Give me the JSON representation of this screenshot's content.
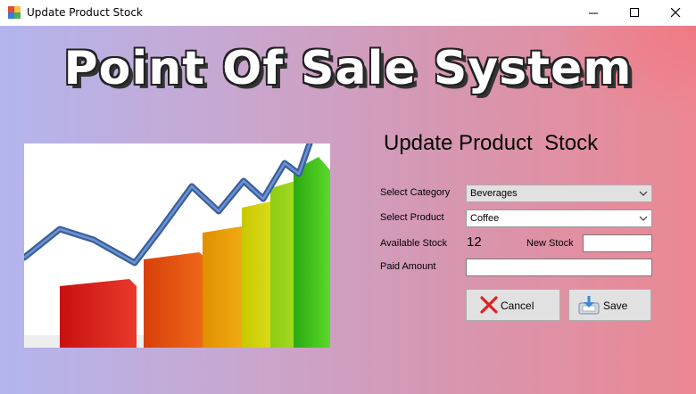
{
  "window": {
    "title": "Update Product Stock",
    "controls": {
      "minimize": "minimize-icon",
      "maximize": "maximize-icon",
      "close": "close-icon"
    }
  },
  "banner": {
    "text": "Point Of Sale System"
  },
  "form": {
    "title": "Update Product  Stock",
    "labels": {
      "category": "Select Category",
      "product": "Select Product",
      "available": "Available Stock",
      "new_stock": "New Stock",
      "paid_amount": "Paid Amount"
    },
    "category": {
      "value": "Beverages"
    },
    "product": {
      "value": "Coffee"
    },
    "available_stock": "12",
    "new_stock": {
      "value": ""
    },
    "paid_amount": {
      "value": ""
    }
  },
  "buttons": {
    "cancel": {
      "label": "Cancel",
      "icon": "red-x-icon"
    },
    "save": {
      "label": "Save",
      "icon": "save-icon"
    }
  },
  "colors": {
    "bg_left": "#b3b5ee",
    "bg_right": "#ec8893",
    "cancel_icon": "#e02020"
  }
}
